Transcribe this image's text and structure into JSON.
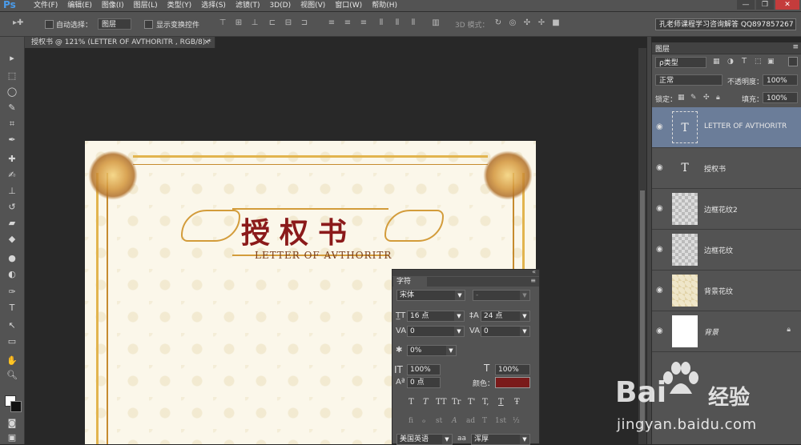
{
  "app": {
    "logo": "Ps"
  },
  "menu": [
    "文件(F)",
    "编辑(E)",
    "图像(I)",
    "图层(L)",
    "类型(Y)",
    "选择(S)",
    "滤镜(T)",
    "3D(D)",
    "视图(V)",
    "窗口(W)",
    "帮助(H)"
  ],
  "window_controls": {
    "minimize": "—",
    "restore": "❐",
    "close": "✕"
  },
  "options": {
    "auto_select_label": "自动选择：",
    "auto_select_value": "图层",
    "show_transform_label": "显示变换控件",
    "mode_label": "3D 模式：",
    "promo": "孔老师课程学习咨询解答 QQ897857267"
  },
  "document_tab": {
    "title": "授权书 @ 121% (LETTER OF AVTHORITR , RGB/8) *",
    "close": "×"
  },
  "document": {
    "title": "授权书",
    "subtitle": "LETTER OF AVTHORITR"
  },
  "layers_panel": {
    "title": "图层",
    "filter_label": "ρ类型",
    "blend_mode": "正常",
    "opacity_label": "不透明度：",
    "opacity_value": "100%",
    "lock_label": "锁定：",
    "fill_label": "填充：",
    "fill_value": "100%",
    "layers": [
      {
        "name": "LETTER OF AVTHORITR",
        "kind": "text",
        "selected": true
      },
      {
        "name": "授权书",
        "kind": "text",
        "selected": false
      },
      {
        "name": "边框花纹2",
        "kind": "transparent",
        "selected": false
      },
      {
        "name": "边框花纹",
        "kind": "transparent",
        "selected": false
      },
      {
        "name": "背景花纹",
        "kind": "pattern",
        "selected": false
      },
      {
        "name": "背景",
        "kind": "white",
        "selected": false,
        "locked": true
      }
    ]
  },
  "character_panel": {
    "tab": "字符",
    "font_family": "宋体",
    "font_style": "-",
    "font_size": "16 点",
    "leading": "24 点",
    "kerning": "0",
    "tracking": "0",
    "scale_percent": "0%",
    "vertical_scale": "100%",
    "horizontal_scale": "100%",
    "baseline_shift": "0 点",
    "color_label": "颜色：",
    "style_buttons": [
      "T",
      "T",
      "TT",
      "Tr",
      "T'",
      "T,",
      "T",
      "Ŧ"
    ],
    "opentype_buttons": [
      "fi",
      "ℴ",
      "st",
      "A",
      "ad",
      "T",
      "1st",
      "½"
    ],
    "language": "美国英语",
    "antialias_label": "aa",
    "antialias": "浑厚"
  },
  "colors": {
    "text_color": "#7a1a1a",
    "selected_layer": "#6b7d99"
  },
  "watermark": {
    "brand": "Bai",
    "brand_suffix": "经验",
    "url": "jingyan.baidu.com"
  }
}
